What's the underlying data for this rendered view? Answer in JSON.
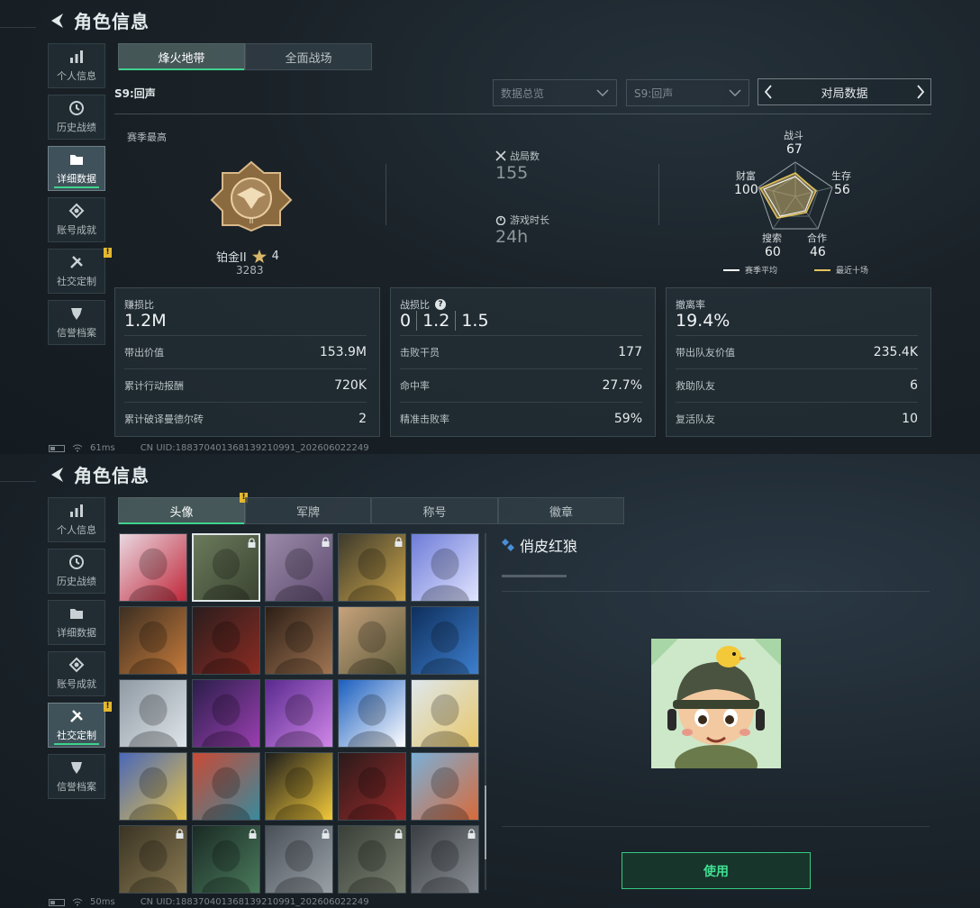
{
  "header": {
    "title": "角色信息"
  },
  "sidebar": {
    "items": [
      {
        "label": "个人信息",
        "icon": "bar-chart-icon"
      },
      {
        "label": "历史战绩",
        "icon": "clock-icon"
      },
      {
        "label": "详细数据",
        "icon": "folder-icon"
      },
      {
        "label": "账号成就",
        "icon": "achievement-icon"
      },
      {
        "label": "社交定制",
        "icon": "tools-icon",
        "badge": "!"
      },
      {
        "label": "信誉档案",
        "icon": "shield-icon"
      }
    ]
  },
  "stats_page": {
    "tabs": [
      "烽火地带",
      "全面战场"
    ],
    "season": "S9:回声",
    "filters": {
      "overview": "数据总览",
      "season_select": "S9:回声",
      "mode": "对局数据"
    },
    "season_best_label": "赛季最高",
    "rank": {
      "name": "铂金II",
      "stars": "4",
      "score": "3283"
    },
    "matches": {
      "label": "战局数",
      "value": "155"
    },
    "playtime": {
      "label": "游戏时长",
      "value": "24h"
    },
    "radar": {
      "labels": {
        "combat": "战斗",
        "survival": "生存",
        "cooperation": "合作",
        "search": "搜索",
        "wealth": "财富"
      },
      "values": {
        "combat": "67",
        "survival": "56",
        "cooperation": "46",
        "search": "60",
        "wealth": "100"
      },
      "legend": {
        "season_avg": "赛季平均",
        "last_ten": "最近十场"
      }
    },
    "cards": [
      {
        "label": "赚损比",
        "value": "1.2M",
        "rows": [
          {
            "label": "带出价值",
            "value": "153.9M"
          },
          {
            "label": "累计行动报酬",
            "value": "720K"
          },
          {
            "label": "累计破译曼德尔砖",
            "value": "2"
          }
        ]
      },
      {
        "label": "战损比",
        "values": [
          "0",
          "1.2",
          "1.5"
        ],
        "help": "?",
        "rows": [
          {
            "label": "击败干员",
            "value": "177"
          },
          {
            "label": "命中率",
            "value": "27.7%"
          },
          {
            "label": "精准击败率",
            "value": "59%"
          }
        ]
      },
      {
        "label": "撤离率",
        "value": "19.4%",
        "rows": [
          {
            "label": "带出队友价值",
            "value": "235.4K"
          },
          {
            "label": "救助队友",
            "value": "6"
          },
          {
            "label": "复活队友",
            "value": "10"
          }
        ]
      }
    ],
    "footer": {
      "ping": "61ms",
      "uid": "CN UID:1883704013681392109​91_202606022249"
    }
  },
  "custom_page": {
    "tabs": [
      "头像",
      "军牌",
      "称号",
      "徽章"
    ],
    "selected_name": "俏皮红狼",
    "use_label": "使用",
    "footer": {
      "ping": "50ms",
      "uid": "CN UID:1883704013681392109​91_202606022249"
    },
    "avatars": [
      {
        "name": "rose-skull",
        "c1": "#e9d7e0",
        "c2": "#c0283a",
        "locked": false
      },
      {
        "name": "soldier-chibi",
        "c1": "#6b7a5c",
        "c2": "#3b4431",
        "locked": true,
        "selected": true
      },
      {
        "name": "cat-girl",
        "c1": "#9a8aa8",
        "c2": "#5f4b70",
        "locked": true
      },
      {
        "name": "triangle-emblem",
        "c1": "#3d3a2c",
        "c2": "#c9a34a",
        "locked": true
      },
      {
        "name": "voyager",
        "c1": "#6e7cd8",
        "c2": "#e0e4ff",
        "locked": false
      },
      {
        "name": "helmet-soldier",
        "c1": "#3c2f22",
        "c2": "#c57a3a",
        "locked": false
      },
      {
        "name": "suit-man",
        "c1": "#2a1d1d",
        "c2": "#8a2b22",
        "locked": false
      },
      {
        "name": "bearded-man",
        "c1": "#2c1e16",
        "c2": "#a07552",
        "locked": false
      },
      {
        "name": "desert-soldier",
        "c1": "#c6a27c",
        "c2": "#5d5b3b",
        "locked": false
      },
      {
        "name": "blue-robot",
        "c1": "#0e2f5c",
        "c2": "#3d7fcf",
        "locked": false
      },
      {
        "name": "mountain-chair",
        "c1": "#8f9aa3",
        "c2": "#dfe5ea",
        "locked": false
      },
      {
        "name": "glasses-man",
        "c1": "#2a1e4a",
        "c2": "#9a3fb0",
        "locked": false
      },
      {
        "name": "purple-girl",
        "c1": "#5a2a8f",
        "c2": "#d086e8",
        "locked": false
      },
      {
        "name": "havk-logo",
        "c1": "#1b5fc0",
        "c2": "#ffffff",
        "locked": false
      },
      {
        "name": "blonde-cartoon",
        "c1": "#dde7ec",
        "c2": "#e8c76a",
        "locked": false
      },
      {
        "name": "gold-mascot",
        "c1": "#4a68b8",
        "c2": "#e2c04a",
        "locked": false
      },
      {
        "name": "octopus",
        "c1": "#c94a36",
        "c2": "#3a8a9c",
        "locked": false
      },
      {
        "name": "goose-tape",
        "c1": "#1c1c1c",
        "c2": "#f2c93a",
        "locked": false
      },
      {
        "name": "masked-figure",
        "c1": "#2a1a1a",
        "c2": "#9a2a2a",
        "locked": false
      },
      {
        "name": "redhead-pinup",
        "c1": "#7ab0d8",
        "c2": "#d86a3a",
        "locked": false
      },
      {
        "name": "bald-operator",
        "c1": "#3a3424",
        "c2": "#8a7a52",
        "locked": true
      },
      {
        "name": "dark-hair-man",
        "c1": "#1a2a24",
        "c2": "#4a7a5c",
        "locked": true
      },
      {
        "name": "gear-emblem",
        "c1": "#4a5058",
        "c2": "#9aa2a8",
        "locked": true
      },
      {
        "name": "battlefield",
        "c1": "#3a4038",
        "c2": "#7a8070",
        "locked": true
      },
      {
        "name": "eri-globe",
        "c1": "#3a3e42",
        "c2": "#8a9096",
        "locked": true
      }
    ]
  },
  "colors": {
    "accent": "#3fd28c",
    "warning": "#e4b830",
    "radar_season": "#ffffff",
    "radar_recent": "#e3c35a"
  }
}
